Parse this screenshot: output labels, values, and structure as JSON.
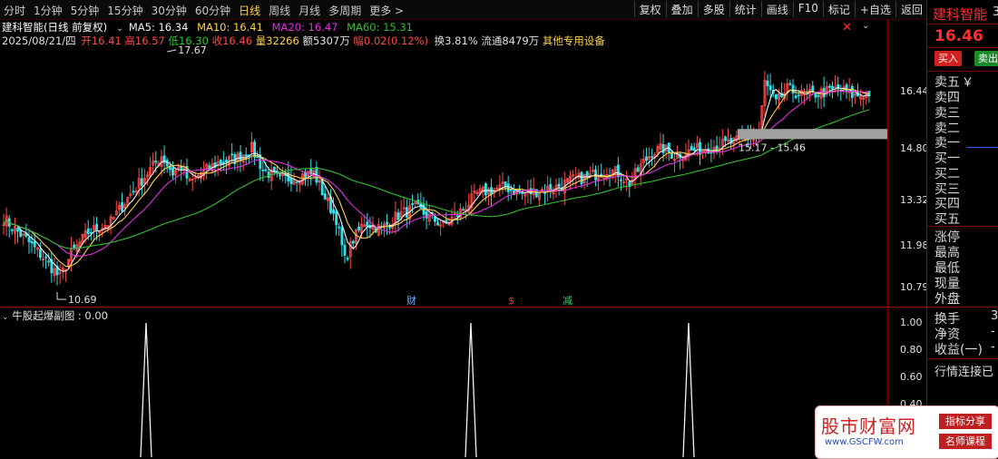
{
  "toolbar": {
    "periods": [
      "分时",
      "1分钟",
      "5分钟",
      "15分钟",
      "30分钟",
      "60分钟",
      "日线",
      "周线",
      "月线",
      "多周期",
      "更多"
    ],
    "active_period": "日线",
    "more_arrow": ">",
    "buttons": [
      "复权",
      "叠加",
      "多股",
      "统计",
      "画线",
      "F10",
      "标记",
      "+自选",
      "返回"
    ]
  },
  "header": {
    "title": "建科智能(日线 前复权)",
    "ma5": "MA5: 16.34",
    "ma10": "MA10: 16.41",
    "ma20": "MA20: 16.47",
    "ma60": "MA60: 15.31",
    "date": "2025/08/21/四",
    "open_label": "开",
    "open": "16.41",
    "high_label": "高",
    "high": "16.57",
    "low_label": "低",
    "low": "16.30",
    "close_label": "收",
    "close": "16.46",
    "vol_label": "量",
    "vol": "32266",
    "amount_label": "额",
    "amount": "5307万",
    "amp_label": "幅",
    "amp": "0.02(0.12%)",
    "turnover": "换3.81%",
    "float": "流通8479万",
    "extra": "其他专用设备"
  },
  "chart_labels": {
    "high_mark": "17.67",
    "low_mark": "10.69",
    "range_label": "15.17 - 15.46",
    "event_cai": "财",
    "event_song": "$",
    "event_jian": "减"
  },
  "price_ticks": [
    "16.44",
    "14.80",
    "13.32",
    "11.98",
    "10.79"
  ],
  "indicator": {
    "title": "牛股起爆副图 : 0.00",
    "ticks": [
      "1.00",
      "0.80",
      "0.60",
      "0.40"
    ]
  },
  "right_panel": {
    "stock_name": "建科智能",
    "stock_code_partial": "3",
    "price": "16.46",
    "buy_btn": "买入",
    "sell_btn": "卖出",
    "sell_levels": [
      "卖五",
      "卖四",
      "卖三",
      "卖二",
      "卖一"
    ],
    "buy_levels": [
      "买一",
      "买二",
      "买三",
      "买四",
      "买五"
    ],
    "yen": "￥",
    "stats": [
      "涨停",
      "最高",
      "最低",
      "现量",
      "外盘"
    ],
    "stats2": [
      "换手",
      "净资",
      "收益(一)"
    ],
    "stats2_right": [
      "3",
      "-",
      "-"
    ],
    "status": "行情连接已"
  },
  "watermark": {
    "site": "股市财富网",
    "url": "www.GSCFW.com",
    "tag1": "指标分享",
    "tag2": "名师课程"
  },
  "colors": {
    "up": "#ff4a4a",
    "down": "#30e0e8",
    "ma5": "#f0f0f0",
    "ma10": "#ffd24a",
    "ma20": "#e030e0",
    "ma60": "#30c030",
    "accent_red": "#ff3030"
  }
}
